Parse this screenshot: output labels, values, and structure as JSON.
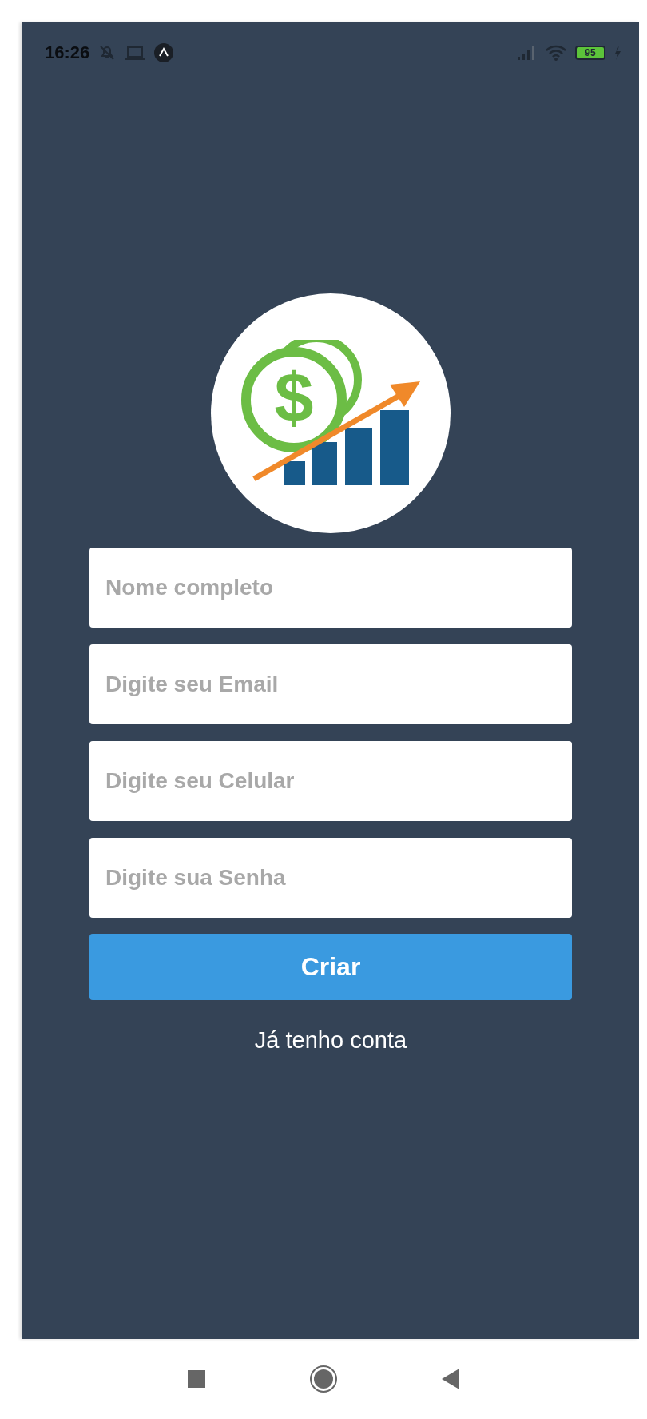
{
  "status_bar": {
    "time": "16:26",
    "battery": "95"
  },
  "logo": {
    "symbol": "$"
  },
  "form": {
    "fields": [
      {
        "placeholder": "Nome completo"
      },
      {
        "placeholder": "Digite seu Email"
      },
      {
        "placeholder": "Digite seu Celular"
      },
      {
        "placeholder": "Digite sua Senha"
      }
    ],
    "submit": "Criar",
    "link": "Já tenho conta"
  }
}
